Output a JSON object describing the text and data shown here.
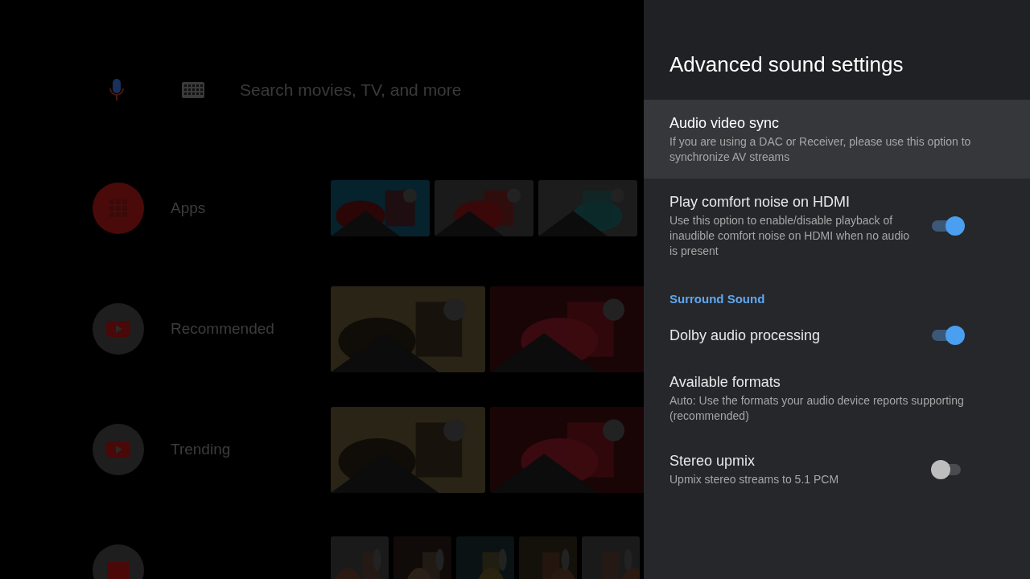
{
  "search": {
    "placeholder": "Search movies, TV, and more"
  },
  "rows": [
    {
      "label": "Apps",
      "kind": "apps"
    },
    {
      "label": "Recommended",
      "kind": "video"
    },
    {
      "label": "Trending",
      "kind": "video"
    },
    {
      "kind": "posters"
    }
  ],
  "panel": {
    "title": "Advanced sound settings",
    "items": [
      {
        "kind": "item",
        "title": "Audio video sync",
        "summary": "If you are using a DAC or Receiver, please use this option to synchronize AV streams",
        "selected": true
      },
      {
        "kind": "toggle",
        "title": "Play comfort noise on HDMI",
        "summary": "Use this option to enable/disable playback of inaudible comfort noise on HDMI when no audio is present",
        "on": true,
        "selected": false
      },
      {
        "kind": "header",
        "title": "Surround Sound"
      },
      {
        "kind": "toggle",
        "title": "Dolby audio processing",
        "on": true,
        "selected": false
      },
      {
        "kind": "item",
        "title": "Available formats",
        "summary": "Auto: Use the formats your audio device reports supporting (recommended)",
        "selected": false
      },
      {
        "kind": "toggle",
        "title": "Stereo upmix",
        "summary": "Upmix stereo streams to 5.1 PCM",
        "on": false,
        "selected": false
      }
    ]
  }
}
